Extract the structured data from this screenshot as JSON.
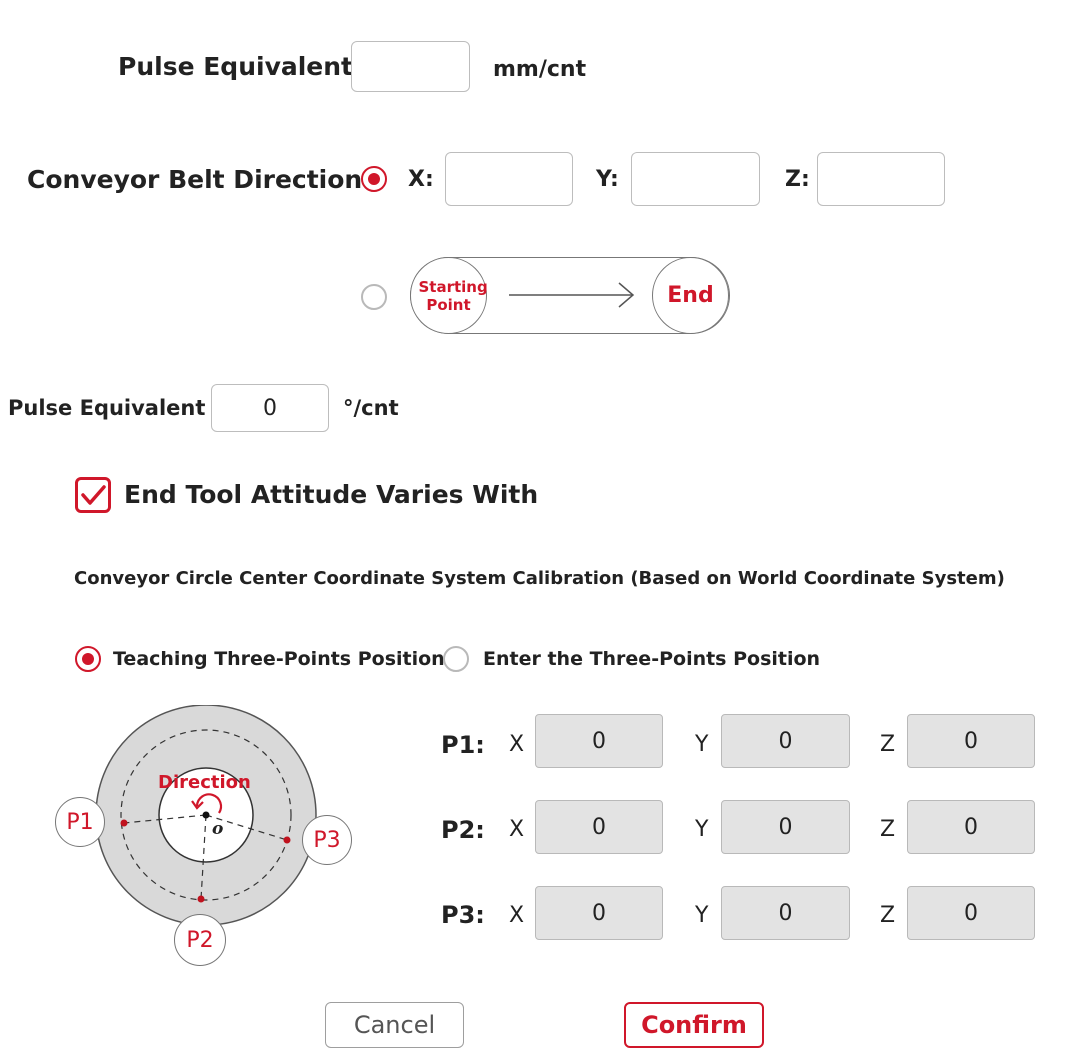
{
  "pulse_equivalent_linear": {
    "label": "Pulse Equivalent",
    "value": "",
    "unit": "mm/cnt"
  },
  "conveyor_direction": {
    "label": "Conveyor Belt Direction",
    "option_xyz_selected": true,
    "x_label": "X:",
    "x_value": "",
    "y_label": "Y:",
    "y_value": "",
    "z_label": "Z:",
    "z_value": "",
    "belt": {
      "start_label": "Starting Point",
      "end_label": "End"
    }
  },
  "pulse_equivalent_angular": {
    "label": "Pulse Equivalent",
    "value": "0",
    "unit": "°/cnt"
  },
  "attitude_checkbox": {
    "label": "End Tool Attitude Varies With",
    "checked": true
  },
  "calibration": {
    "title": "Conveyor Circle Center Coordinate System Calibration (Based on World Coordinate System)",
    "mode_teach": "Teaching Three-Points Position",
    "mode_enter": "Enter the Three-Points Position",
    "selected_mode": "teach"
  },
  "diagram": {
    "direction_label": "Direction",
    "center_label": "o",
    "p1": "P1",
    "p2": "P2",
    "p3": "P3"
  },
  "points": [
    {
      "label": "P1:",
      "x": "0",
      "y": "0",
      "z": "0"
    },
    {
      "label": "P2:",
      "x": "0",
      "y": "0",
      "z": "0"
    },
    {
      "label": "P3:",
      "x": "0",
      "y": "0",
      "z": "0"
    }
  ],
  "axis_labels": {
    "x": "X",
    "y": "Y",
    "z": "Z"
  },
  "buttons": {
    "cancel": "Cancel",
    "confirm": "Confirm"
  },
  "colors": {
    "accent": "#d0172a",
    "field_gray": "#e3e3e3",
    "border": "#bdbdbd"
  }
}
